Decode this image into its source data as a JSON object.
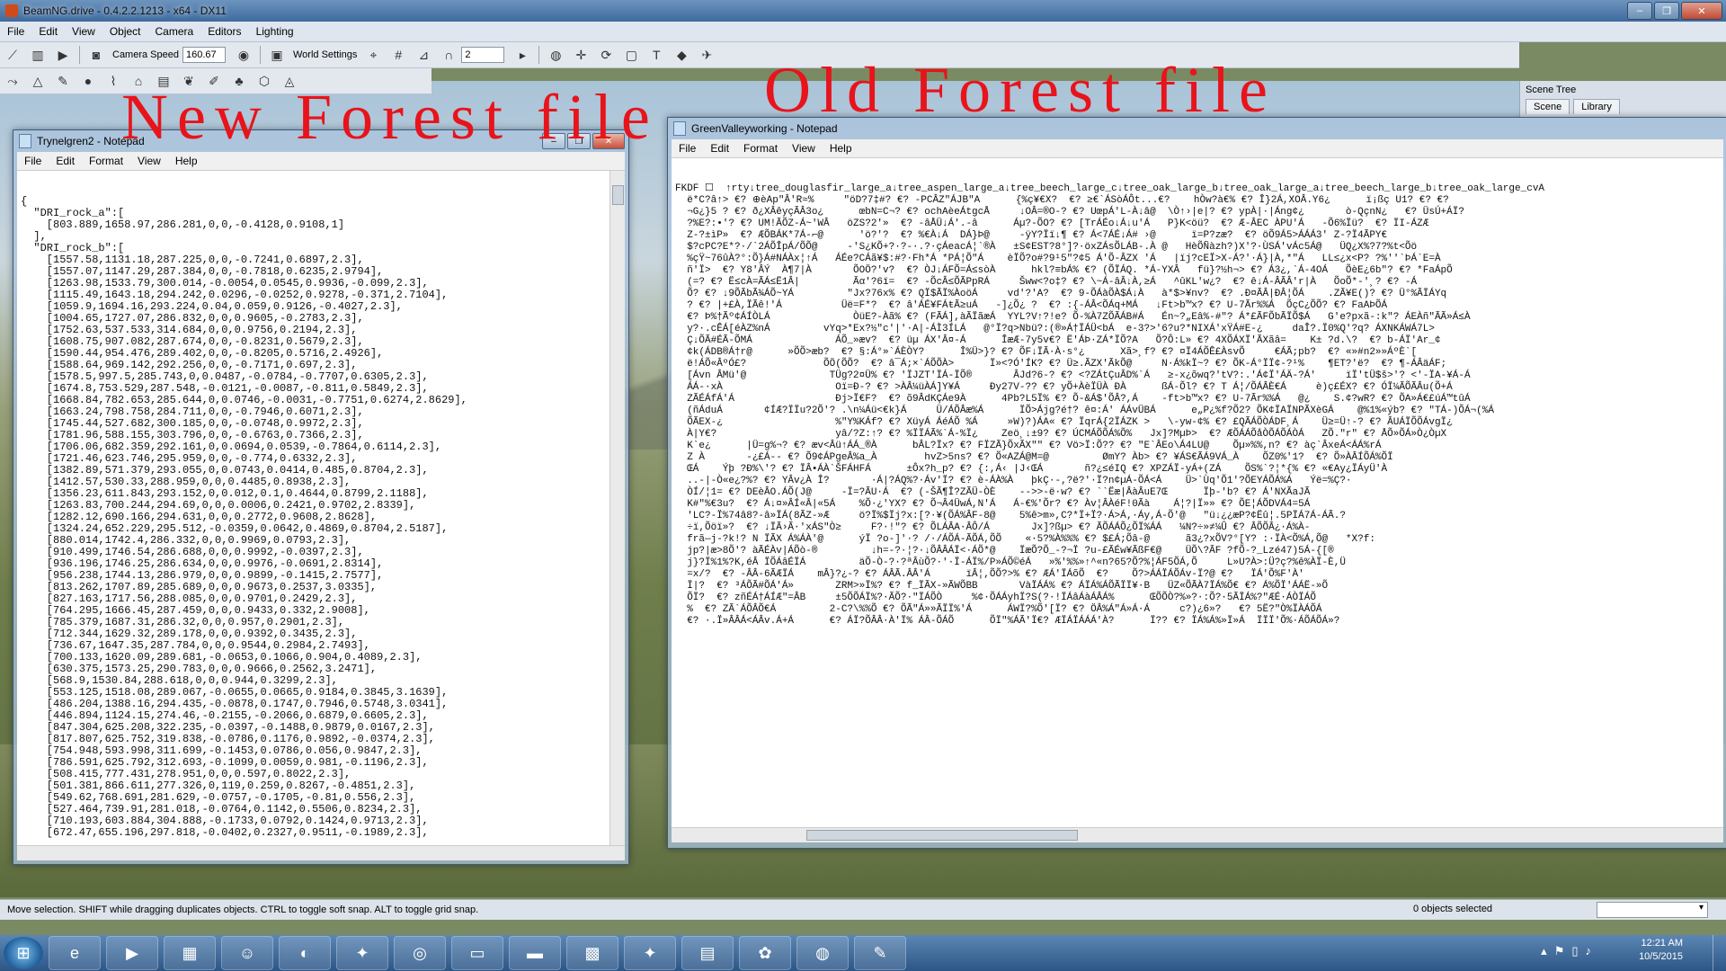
{
  "app": {
    "title": "BeamNG.drive - 0.4.2.2.1213 - x64 - DX11",
    "window_buttons": [
      "–",
      "❐",
      "✕"
    ]
  },
  "menubar": [
    "File",
    "Edit",
    "View",
    "Object",
    "Camera",
    "Editors",
    "Lighting"
  ],
  "toolbar": {
    "camera_speed_label": "Camera Speed",
    "camera_speed_value": "160.67",
    "world_settings_label": "World Settings",
    "grid_value": "2"
  },
  "annotations": {
    "new": "New Forest file",
    "old": "Old Forest file"
  },
  "scene_tree": {
    "title": "Scene Tree",
    "tabs": [
      "Scene",
      "Library"
    ]
  },
  "notepad_new": {
    "title": "Trynelgren2 - Notepad",
    "menu": [
      "File",
      "Edit",
      "Format",
      "View",
      "Help"
    ],
    "content": "{\n  \"DRI_rock_a\":[\n    [803.889,1658.97,286.281,0,0,-0.4128,0.9108,1]\n  ],\n  \"DRI_rock_b\":[\n    [1557.58,1131.18,287.225,0,0,-0.7241,0.6897,2.3],\n    [1557.07,1147.29,287.384,0,0,-0.7818,0.6235,2.9794],\n    [1263.98,1533.79,300.014,-0.0054,0.0545,0.9936,-0.099,2.3],\n    [1115.49,1643.18,294.242,0.0296,-0.0252,0.9278,-0.371,2.7104],\n    [1059.9,1694.16,293.224,0.04,0.059,0.9126,-0.4027,2.3],\n    [1004.65,1727.07,286.832,0,0,0.9605,-0.2783,2.3],\n    [1752.63,537.533,314.684,0,0,0.9756,0.2194,2.3],\n    [1608.75,907.082,287.674,0,0,-0.8231,0.5679,2.3],\n    [1590.44,954.476,289.402,0,0,-0.8205,0.5716,2.4926],\n    [1588.64,969.142,292.256,0,0,-0.7171,0.697,2.3],\n    [1578.5,997.5,285.743,0,0.0487,-0.0784,-0.7707,0.6305,2.3],\n    [1674.8,753.529,287.548,-0.0121,-0.0087,-0.811,0.5849,2.3],\n    [1668.84,782.653,285.644,0,0.0746,-0.0031,-0.7751,0.6274,2.8629],\n    [1663.24,798.758,284.711,0,0,-0.7946,0.6071,2.3],\n    [1745.44,527.682,300.185,0,0,-0.0748,0.9972,2.3],\n    [1781.96,588.155,303.796,0,0,-0.6763,0.7366,2.3],\n    [1706.06,682.359,292.161,0,0.0694,0.0539,-0.7864,0.6114,2.3],\n    [1721.46,623.746,295.959,0,0,-0.774,0.6332,2.3],\n    [1382.89,571.379,293.055,0,0.0743,0.0414,0.485,0.8704,2.3],\n    [1412.57,530.33,288.959,0,0,0.4485,0.8938,2.3],\n    [1356.23,611.843,293.152,0,0.012,0.1,0.4644,0.8799,2.1188],\n    [1263.83,700.244,294.69,0,0,0.0006,0.2421,0.9702,2.8339],\n    [1282.12,690.166,294.631,0,0,0.2772,0.9608,2.8628],\n    [1324.24,652.229,295.512,-0.0359,0.0642,0.4869,0.8704,2.5187],\n    [880.014,1742.4,286.332,0,0,0.9969,0.0793,2.3],\n    [910.499,1746.54,286.688,0,0,0.9992,-0.0397,2.3],\n    [936.196,1746.25,286.634,0,0,0.9976,-0.0691,2.8314],\n    [956.238,1744.13,286.979,0,0,0.9899,-0.1415,2.7577],\n    [813.262,1707.89,285.689,0,0,0.9673,0.2537,3.0335],\n    [827.163,1717.56,288.085,0,0,0.9701,0.2429,2.3],\n    [764.295,1666.45,287.459,0,0,0.9433,0.332,2.9008],\n    [785.379,1687.31,286.32,0,0,0.957,0.2901,2.3],\n    [712.344,1629.32,289.178,0,0,0.9392,0.3435,2.3],\n    [736.67,1647.35,287.784,0,0,0.9544,0.2984,2.7493],\n    [700.133,1620.09,289.681,-0.0653,0.1066,0.904,0.4089,2.3],\n    [630.375,1573.25,290.783,0,0,0.9666,0.2562,3.2471],\n    [568.9,1530.84,288.618,0,0,0.944,0.3299,2.3],\n    [553.125,1518.08,289.067,-0.0655,0.0665,0.9184,0.3845,3.1639],\n    [486.204,1388.16,294.435,-0.0878,0.1747,0.7946,0.5748,3.0341],\n    [446.894,1124.15,274.46,-0.2155,-0.2066,0.6879,0.6605,2.3],\n    [847.304,625.208,322.235,-0.0397,-0.1488,0.9879,0.0167,2.3],\n    [817.807,625.752,319.838,-0.0786,0.1176,0.9892,-0.0374,2.3],\n    [754.948,593.998,311.699,-0.1453,0.0786,0.056,0.9847,2.3],\n    [786.591,625.792,312.693,-0.1099,0.0059,0.981,-0.1196,2.3],\n    [508.415,777.431,278.951,0,0,0.597,0.8022,2.3],\n    [501.381,866.611,277.326,0,119,0.259,0.8267,-0.4851,2.3],\n    [549.62,768.691,281.629,-0.0757,-0.1705,-0.81,0.556,2.3],\n    [527.464,739.91,281.018,-0.0764,0.1142,0.5506,0.8234,2.3],\n    [710.193,603.884,304.888,-0.1733,0.0792,0.1424,0.9713,2.3],\n    [672.47,655.196,297.818,-0.0402,0.2327,0.9511,-0.1989,2.3],"
  },
  "notepad_old": {
    "title": "GreenValleyworking - Notepad",
    "menu": [
      "File",
      "Edit",
      "Format",
      "View",
      "Help"
    ],
    "content": "FKDF ☐  ↑rty↓tree_douglasfir_large_a↓tree_aspen_large_a↓tree_beech_large_c↓tree_oak_large_b↓tree_oak_large_a↓tree_beech_large_b↓tree_oak_large_cvA\n  ë*C?â↑> €? ⊕èAp\"Â'R≈%     \"öD?7‡#? €? -PCÂZ\"ÁJB\"A      {%ç¥€X?  €? ≥€`ÁSòÁÔt...€?    hÒw?à€% €? Î}2Á,XOÂ.Y6¿      ï¡ßç U1? €? €?\n  ¬G¿}5 ? €? ð¿XÂêyçÃÂ3o¿      œbN=C¬? €? ochAèeÁtgcÅ     ↓OÂ=®O-? €? UœpÁ'L-À↓â@  \\Ò↑›|e|? €? ypÀ|·|Áng¢¿       ò-QçnN¿   €? ÜsÚ+ÁÏ?\n  ?%E?:•'? €? UM!ÃÕZ-Á~'WÂ   öZS?2'»  €? -âÅÜ↓Á'.-â      Áµ?-ÕO? €? [TrÁÉo↓Á↓u'Á   P}K<öü?  €? Æ-ÂEC ÀPU'Á   -Õ6%Ïü?  €? ÏI-ÁZÆ\n  Z-?±ìP»  €? ÆÕBÁK*7Á-⌐@      'ö?'?  €? %€À↓Á  DÁ}Þ@     -ÿY?Ïï↓¶ €? Á<7ÁÉ↓Á# ›@      ï=P?zæ?  €? öÕ9Á5>ÁÁÁ3' Z-?Ï4ÃPY€\n  $?cPC?E*?·/`2ÁÕÎpÁ/ÕÕ@     -'S¿KÕ+?·?-·.?·çÁeacÁ¦`®À   ±S¢EST?8°]?·öxZÁsÕLÁB-.À @   HèÕÑàzh?)X'?·ÙSÁ'vÁc5Á@   ÜQ¿X%?7?%t<Õö\n  %çŸ~76ûÀ?°:Õ}Á#NÁÀx¦↑Á   ÁÉe?CÁã¥$:#?·Fh*Á *PÁ¦Õ\"Á    èÏÕ?o#?9¹5\"?¢5 Á'Õ-ÂZX 'Á   |ïj?cEÏ>X-Á?'·Á}|À,*\"Á   LL≤¿x<P? ?%''`ÞÁ`E=À\n  ñ'Ï>  €? Y8'ÂÝ  À¶7|À       ÕOÖ?'v?  €? ÒJ↓ÁFÕ=Á≤sòÀ      hkl?≡bÁ% €? (ÕÏÁQ. *Á-YXÂ   fü}?½h¬> €? Á3¿,`Á-4OÁ   ÕèE¿6b\"? €? *FaÁpÕ\n  (=? €? Ë≤cÀ=ÃÁ≤Ë1Â|         Ãα'?6ï=  €? -ÕcÂ≤ÕÃPpRÁ     Šww<?o‡? €? \\~Á-âÂ↓À,≥Á   ^ûKL'w¿?  €? ê↓Á-ÂÃÂ'r|À   ÕoÕ*-'¸? €? -Á\n  Õ? €? ↓9ÕÃbÃ¾ÁÕ~YÁ         \"Jx?76x% €? QÏ$ÃÏ%ÀoöÁ     vd'?'A?  €? 9-ÕÁàÕÀ$Á↓À   à*$>¥nv?  €? .Ð¤ÃÂ|ÐÂ¦ÕÁ    .ZÃ¥E()? €? Ü°%ÃÏÁYq\n  ? €? |+£À,ÏÃê!'Á          Üë=F*?  €? â'ÁÉ¥FÁŧÃ≥uÁ   -]¿Õ¿ ?  €? :{-ÁÂ<ÕÁq+MÁ   ↓Ft>b™x? €? U-7Ãr%%Á  ÕçC¿ÕÕ? €? FaAÞÕÁ\n  €? Þ%†Ãº¢ÁÍÒLÁ              ÒüE?-Àã% €? (FÃÁ],àÃÏãæÁ  YYL?V↑?!e? Õ-%À7ZÕÃÁB#Á   Én~?„Eâ%-#\"? Á*£ÃFÕbÃÏÕ$Á   G'e?pxã-:k\"? ÁEÀñ\"ÃÃ»Á≤À\n  y?·.cÊÁ[éÀZ%nÁ         vYq>*Ex?½\"c'|'·A|-ÁÌ3ÍLÁ   @°Ï?q>Nbü?:(®»Á†ÏÁÜ<bÁ  e-3?>'6?u?*NIXÁ'xŸÁ#E-¿     daÎ?.Ï0%Q'?q? ÁXNKÁWÁ7L>\n  Ç↓ÕÃ#ÉÃ-ÕMÁ              ÁÕ_»æv?  €? üµ ÁX'Â¤-Á      ÎæÆ-7y5v€? Ë'ÁÞ·ZÁ*ÏÕ?A   Õ?Ô:L» €? 4XÕÁXÏ'ÃXãâ=    K± ?d.\\?  €? b-ÁÏ'Ar_¢\n  ¢k(ÁDB®Á†r@      »ÕÕ>æb?  €? §:Á°»`ÁÈÒY?      Î%Ü>}? €? ÕF↓ÏÃ·À·s°¿      Xã>¸f? €? ¤Ï4ÁÕÊ£ÀsvÕ     €ÁÃ;pb?  €? «»#n2»»ÁºÈ`[\n  ë!ÁÕ«ÂºÓ£?             ÕÖ(ÕÕ?  €? â¯Á;×`ÁÕÕÀ>      Ï»<?Ó'ÍK? €? Ü≥.ÃZX'ÃkÕ@     N·Á%kÏ~? €? ÕK-Á°ÏÏ¢-?¹%    ¶ET?'ë?  €? ¶-ÁÂäÁF;\n  [Ávn ÂMü'@              TÜg?2¤Ü% €? 'ÏJZT'ÏÁ-ÏÕ®       ÂJd?6-? €? <?ZÁtÇuÂD%`Á   ≥-x¿õwq?'tV?:.'Á¢Ï'ÁÄ-?Á'     ïÏ'tÜ$š>'? <'-ÏA-¥Á-Á\n  ÁÁ-·xÀ                   Oï=Ð-? €? >ÀÂ¼üÀÁ]Y¥Á     Ðy27V-?? €? yÕ+ÀèÏÜÀ ÐÀ      ßÁ-Õl? €? T Á¦/ÕÁÂÈ€Á     è)ç£ÉX? €? ÓÏ¼ÃÕÃÂu(Õ+Á\n  ZÃÉÁfÁ'Á                 Ðj>Ï€F?  €? õ9ÂdKÇÁe9À      4Pb?L5Ï% €? Õ-&Á$'ÕÂ?,Á    -ft>b™x? €? U-7Ãr%%Á   @¿    S.¢?wR? €? ÕA»Á€£úÁ™tûÁ\n  (ñÁduÁ       ¢ÍÆ?ÏÏu?2Õ'? .\\n¼Áü<€k}Á     Ü/ÁÕÂæ%Á      ÏÕ>Ájg?é†? ê¤:Á' ÁÁvÜBÁ      e„P¿%f?Õ2? ÕK¢ÏAÏNPÃXèGÁ    @%1%«ýb? €? \"TÁ-)ÕÁ¬(%Á\n  ÕÃEX-¿                   %\"Y%KÁf? €? XüyÁ ÁéÁÕ %Á     »W)?)ÁA« €? ÏqrÁ{2ÏÁZK >   \\-yw-¢% €? £QÃÁÕÒÁDF¸Á    Ü≥=Ü↑-? €? ÂUÁÏÕÕÁvgÏ¿\n  À|Y€?                    yâ/?Z:↑? €? %ÏÏÁÃ%`Á-%Ï¿    Zeö¸↓±9? €? ÚCMÁÕÕÁ%Õ%   Jx]?MµÞ>  €? ÆÕÁÁÕåÒÕÁÕÁÒÁ   ZÕ.\"r\" €? ÅÕ»ÕÁ»Ò¿ÒµX\n  K`e¿      |Ü=g%¬? €? æv<Âü↑ÁÁ_®À      bÂL?Ïx? €? FÏZÃ}ÕxÃX\"\" €? Vö>Ï:Õ?? €? \"E`ÂEo\\Á4LU@    Õµ»%%,n? €? àç`ÂxeÁ<ÁÁ%rÁ\n  Z À       -¿£Á-- €? Õ9¢ÁPgeÂ%a_À        hvZ>5ns? €? Õ«AZÁ@M=@         ØmY? Àb> €? ¥ÁS€ÃÁ9VÁ_À    ÕZ0%'1?  €? Õ»ÀÂÍÕÁ%ÕÏ\n  ŒÁ    Ýþ ?Ð%\\'? €? ÏÂ•ÁÀ`ŠFÁHFÁ      ±Ôx?h_p? €? {:,Á‹ |J‹ŒÁ       ñ?¿≤éIQ €? XPZÁÏ-yÁ+(ZÁ    ÕS%`?¦*{% €? «€Ay¿ÏÁyÜ'À\n  ..-|-Ò«e¿?%? €? YÂv¿À Î?       ·Á|?ÁQ%?·Áv'Ï? €? è-ÁÀ%À   þkÇ·-,?ë?'·Ï?n¢µÁ-ÕÁ<Á    Ü>`Ùq'Õ1'?ÕEYÁÕÁ%Á   Ýë=%Ç?·\n  ÒÍ/¦1= €? DEèÂO.ÁÕ(J@     -Ï=?ÃU·Á  €? (-ŠÃ¶Î?ZÃÜ-ÒÈ    -->>-ë·w? €? ``Ëæ|ÂàÂuE7Œ      Ïþ-'b? €? Á'NXÃaJÃ\n  K#\"%€3u?  €? Á↓¤»ÂÍ«Â|«5Á    %Õ·¿'YX? €? Õ¬Â4ÜwÁ,N'Á   Á-€%'Õr? €? Àv¦ÂÀéF!0Ãà    Á¦?|Ï»» €? ÕE¦ÁÕDVÁ4=5Á\n  'LC?-Ï%74â8?-â»ÏÁ(8ÃZ-»Æ     ö?Ï%$Ïj?x:[?·¥(ÕÁ%ÂF-8@    5%ê>m»,C?*Ï+Ï?·Á>Á‚·Áy,Á-Õ'@   \"ü↓¿¿æP?¢Ëû¦.5PÏÁ7Á-ÁÃ.?\n  ÷ï,Õöï»?  €? ↓ÏÃ›Ã·'xÁS\"Ò≥     F?·!\"? €? ÕLÁÂA·ÂÔ/Á       Jx]?ßµ> €? ÃÕÁÁÕ¿ÕÏ%ÁÁ   ¼N?÷»≠¼Û €? ÂÕÕÂ¿·Á%À-\n  frã—j-?k!? N ÏÃX Á%ÁÀ'@      ýÏ ?o-]'·? /·/ÁÕÁ-ÃÕÁ,ÕÕ    «·5?%À%%% €? $£Á;Õâ-@      ã3¿?xÕV?°[Y? :·ÏÀ<Õ%Á,Õ@   *X?f:\n  jp?|æ>8Õ'? àÃÉÀv|ÁÕò-®         ↓h=-?·¦?·↓ÕÂÂÁÏ<·ÁÕ*@    ÏæÕ?Õ_-?¬Ï ?u-£ÃÉw¥ÃßF€@    ÜÕ\\?ÃF ?fÕ-?_Lzé47)5Á-{[®\n  j}?Ï%1%?K,éÂ ÏÕÁâÉÏÁ         äÕ-Ò-?·?ªÂùÕ?·'·Ï-ÁÏ%/P»ÁÕ©éÁ   »%'%%»↑^«n?65?Õ?%¦ÁF5ÕÁ,Õ     L»U?À>:Ü?ç?%ê%ÀÏ-È,Ü\n  =x/?  €? -ÂÂ-6ÃÆÏÁ    mÂ}?¿-? €? ÁÂÃ.ÂÂ'Á      ïÂ¦,ÕÕ?>% €? ÆÁ'ÏÁõÕ  €?    Õ?>ÁÁÏÁÕÁv-Ï?@ €?   ÏÁ'Õ%F'À'\n  Ï|?  €? ³ÁÕÃ#ÕÁ'Á»       ZRM>»Ï%? €? f_ÏÃX-»ÃWÕBB       VàÏÁÁ% €? ÁÏÁ%ÁÕÃÏÏ¥·B   ÜZ«ÕÃÀ7ÏÁ%Õ€ €? Á%ÕÏ'ÁÁË-»Õ\n  ÕÏ?  €? zñÉÁ†ÁÍÆ\"=ÂB     ±5ÕÕÁÏ%?·ÃÕ?·\"ÏÁÕÒ     %¢·ÕÁÁyhÏ?S(?·!ÏÁâÁàÁÂÁ%      ŒÕÕÒ?%»?·:Õ?·5ÃÏÁ%?\"ÆÉ·ÁÒÏÁÕ\n  %  €? ZÃ`ÁÕÂÕ€Á         2-C?\\%%Õ €? ÕÃ\"Á»»ÃÏÏ%'Á      ÁWÏ?%Õ'[Ï? €? ÖÂ%Á\"Á»Á·Á     c?)¿6»?   €? 5Ë?\"Ò%ÏÀÁÕÁ\n  €? ·.Ï»ÂÂÁ<ÁÂv.Á+Á      €? ÁÏ?ÕÂÂ·À'Ï% ÁÂ-ÕÁÕ      ÕÏ\"%ÁÃ'Ï€? ÆÏÁÏÁÁÁ'À?      Ï?? €? ÏÁ%Á%»Ï»Á  ÏÏÏ'Õ%·ÁÕÁÕÁ»?"
  },
  "statusbar": {
    "hint": "Move selection.  SHIFT while dragging duplicates objects.  CTRL to toggle soft snap.  ALT to toggle grid snap.",
    "selected": "0 objects selected"
  },
  "taskbar": {
    "time": "12:21 AM",
    "date": "10/5/2015"
  }
}
